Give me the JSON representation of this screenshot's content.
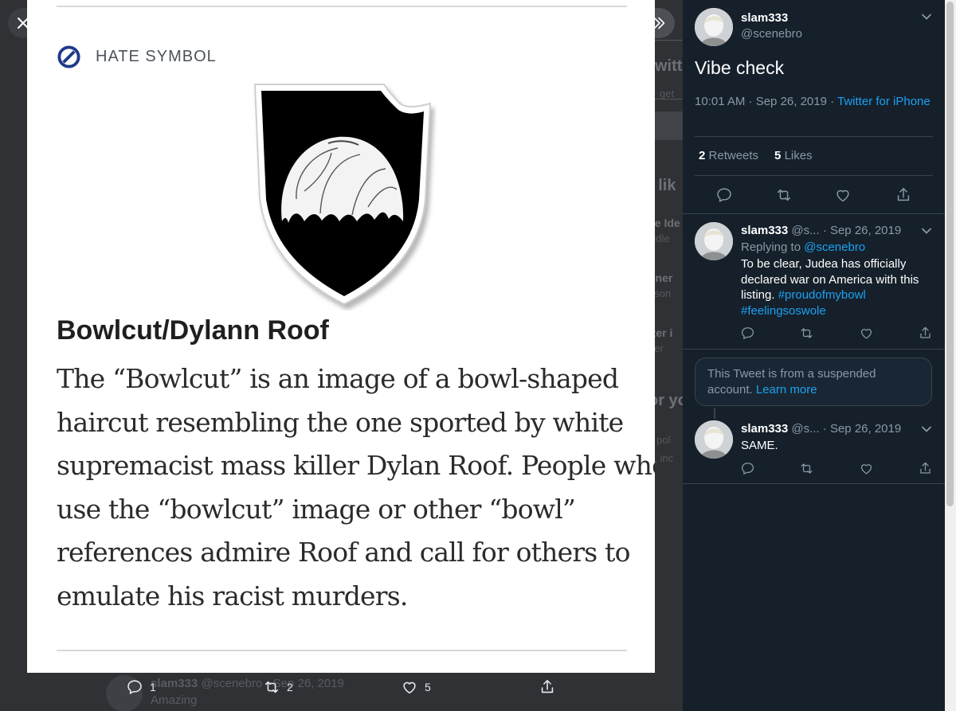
{
  "viewer": {
    "close_label": "Close",
    "expand_label": "Toggle conversation"
  },
  "media": {
    "category_label": "HATE SYMBOL",
    "title": "Bowlcut/Dylann Roof",
    "body_lines": [
      "The “Bowlcut” is an image of a bowl-shaped",
      "haircut resembling the one sported by white",
      "supremacist mass killer Dylan Roof. People who",
      "use the “bowlcut” image or other “bowl”",
      "references admire Roof and call for others to",
      "emulate his racist murders."
    ]
  },
  "background": {
    "fragments": [
      "witt",
      "get",
      "t lik",
      "ce Ide",
      "ddle",
      "nner",
      "rison",
      "tter i",
      "tter",
      "or yo",
      "y pol",
      "n, inc"
    ],
    "tweet": {
      "name": "slam333",
      "handle_date": "@scenebro · Sep 26, 2019",
      "text": "Amazing"
    },
    "actions": {
      "reply_count": "1",
      "retweet_count": "2",
      "like_count": "5"
    }
  },
  "panel": {
    "main_tweet": {
      "name": "slam333",
      "handle": "@scenebro",
      "text": "Vibe check",
      "time": "10:01 AM · Sep 26, 2019 · ",
      "source": "Twitter for iPhone",
      "retweets_count": "2",
      "retweets_label": "Retweets",
      "likes_count": "5",
      "likes_label": "Likes"
    },
    "replies": [
      {
        "name": "slam333",
        "handle": "@s...",
        "date": "· Sep 26, 2019",
        "replying_prefix": "Replying to ",
        "replying_to": "@scenebro",
        "text": "To be clear, Judea has officially declared war on America with this listing. ",
        "hashtag1": "#proudofmybowl",
        "hashtag2": "#feelingsoswole"
      },
      {
        "name": "slam333",
        "handle": "@s...",
        "date": "· Sep 26, 2019",
        "text": "SAME."
      }
    ],
    "suspended_notice": {
      "text": "This Tweet is from a suspended account. ",
      "link": "Learn more"
    }
  },
  "colors": {
    "panel_bg": "#15202b",
    "accent": "#1da1f2",
    "secondary_text": "#8899a6",
    "divider": "#38444d"
  },
  "icons": [
    "close-icon",
    "expand-icon",
    "no-symbol-icon",
    "reply-icon",
    "retweet-icon",
    "like-icon",
    "share-icon",
    "chevron-down-icon"
  ]
}
